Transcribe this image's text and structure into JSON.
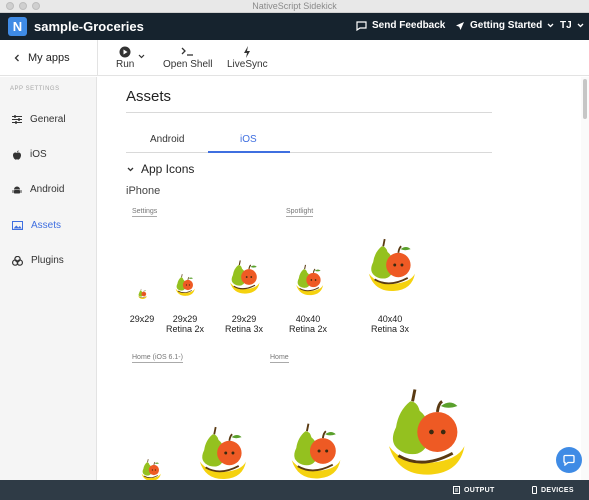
{
  "window": {
    "title": "NativeScript Sidekick"
  },
  "header": {
    "logo": "N",
    "app_name": "sample-Groceries",
    "feedback": "Send Feedback",
    "getting_started": "Getting Started",
    "user": "TJ"
  },
  "toolbar": {
    "back": "My apps",
    "run": "Run",
    "shell": "Open Shell",
    "livesync": "LiveSync"
  },
  "sidebar": {
    "heading": "APP SETTINGS",
    "items": [
      {
        "label": "General",
        "icon": "sliders-icon"
      },
      {
        "label": "iOS",
        "icon": "apple-icon"
      },
      {
        "label": "Android",
        "icon": "android-icon"
      },
      {
        "label": "Assets",
        "icon": "image-icon"
      },
      {
        "label": "Plugins",
        "icon": "plugins-icon"
      }
    ],
    "active": "Assets"
  },
  "main": {
    "title": "Assets",
    "tabs": [
      "Android",
      "iOS"
    ],
    "active_tab": "iOS",
    "section": "App Icons",
    "subsection": "iPhone",
    "groups": [
      "Settings",
      "Spotlight",
      "Home (iOS 6.1-)",
      "Home"
    ],
    "icons": [
      {
        "size": "29x29",
        "note": ""
      },
      {
        "size": "29x29",
        "note": "Retina 2x"
      },
      {
        "size": "29x29",
        "note": "Retina 3x"
      },
      {
        "size": "40x40",
        "note": "Retina 2x"
      },
      {
        "size": "40x40",
        "note": "Retina 3x"
      }
    ]
  },
  "status": {
    "output": "OUTPUT",
    "devices": "DEVICES"
  },
  "colors": {
    "header_bg": "#16232e",
    "accent": "#3f6fe0",
    "logo": "#3f8be5",
    "statusbar": "#2f3b46"
  }
}
